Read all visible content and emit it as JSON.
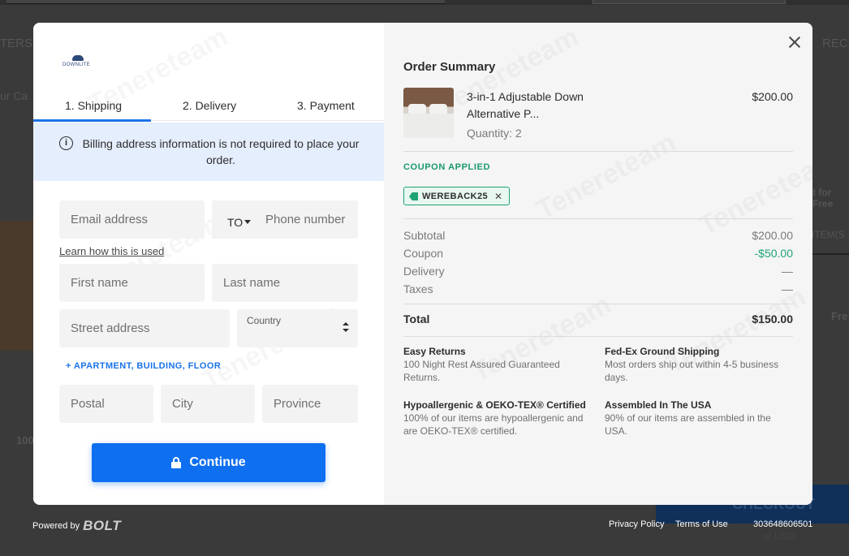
{
  "background": {
    "left_text_1": "TERS",
    "left_text_2": "ur Ca",
    "right_text_1": "REC",
    "right_text_2": "t for Free",
    "right_text_3": "ITEM(S",
    "right_text_4": "Fre",
    "left_text_3": "100",
    "checkout": "CHECKOUT",
    "or_usd": "or USD"
  },
  "brand": {
    "logo_text": "DOWNLITE"
  },
  "steps": {
    "shipping": "1. Shipping",
    "delivery": "2. Delivery",
    "payment": "3. Payment"
  },
  "info": {
    "icon": "info-icon",
    "message": "Billing address information is not required to place your order."
  },
  "form": {
    "email_placeholder": "Email address",
    "phone_prefix": "TO",
    "phone_placeholder": "Phone number",
    "learn_link": "Learn how this is used",
    "first_name_placeholder": "First name",
    "last_name_placeholder": "Last name",
    "street_placeholder": "Street address",
    "country_label": "Country",
    "apartment_link": "+ APARTMENT, BUILDING, FLOOR",
    "postal_placeholder": "Postal",
    "city_placeholder": "City",
    "province_placeholder": "Province",
    "continue_label": "Continue"
  },
  "summary": {
    "title": "Order Summary",
    "item": {
      "name": "3-in-1 Adjustable Down Alternative P...",
      "quantity": "Quantity: 2",
      "price": "$200.00"
    },
    "coupon_label": "COUPON APPLIED",
    "coupon_code": "WEREBACK25",
    "coupon_remove": "✕",
    "rows": [
      {
        "label": "Subtotal",
        "value": "$200.00"
      },
      {
        "label": "Coupon",
        "value": "-$50.00"
      },
      {
        "label": "Delivery",
        "value": "—"
      },
      {
        "label": "Taxes",
        "value": "—"
      }
    ],
    "total_label": "Total",
    "total_value": "$150.00",
    "features": [
      {
        "title": "Easy Returns",
        "text": "100 Night Rest Assured Guaranteed Returns."
      },
      {
        "title": "Fed-Ex Ground Shipping",
        "text": "Most orders ship out within 4-5 business days."
      },
      {
        "title": "Hypoallergenic & OEKO-TEX® Certified",
        "text": "100% of our items are hypoallergenic and are OEKO-TEX® certified."
      },
      {
        "title": "Assembled In The USA",
        "text": "90% of our items are assembled in the USA."
      }
    ]
  },
  "footer": {
    "powered_by": "Powered by",
    "bolt": "BOLT",
    "privacy": "Privacy Policy",
    "terms": "Terms of Use",
    "id": "303648606501"
  },
  "colors": {
    "accent": "#0e6ff0",
    "coupon_green": "#1ea375",
    "info_bg": "#e4eefc"
  },
  "watermark": "Tenereteam"
}
